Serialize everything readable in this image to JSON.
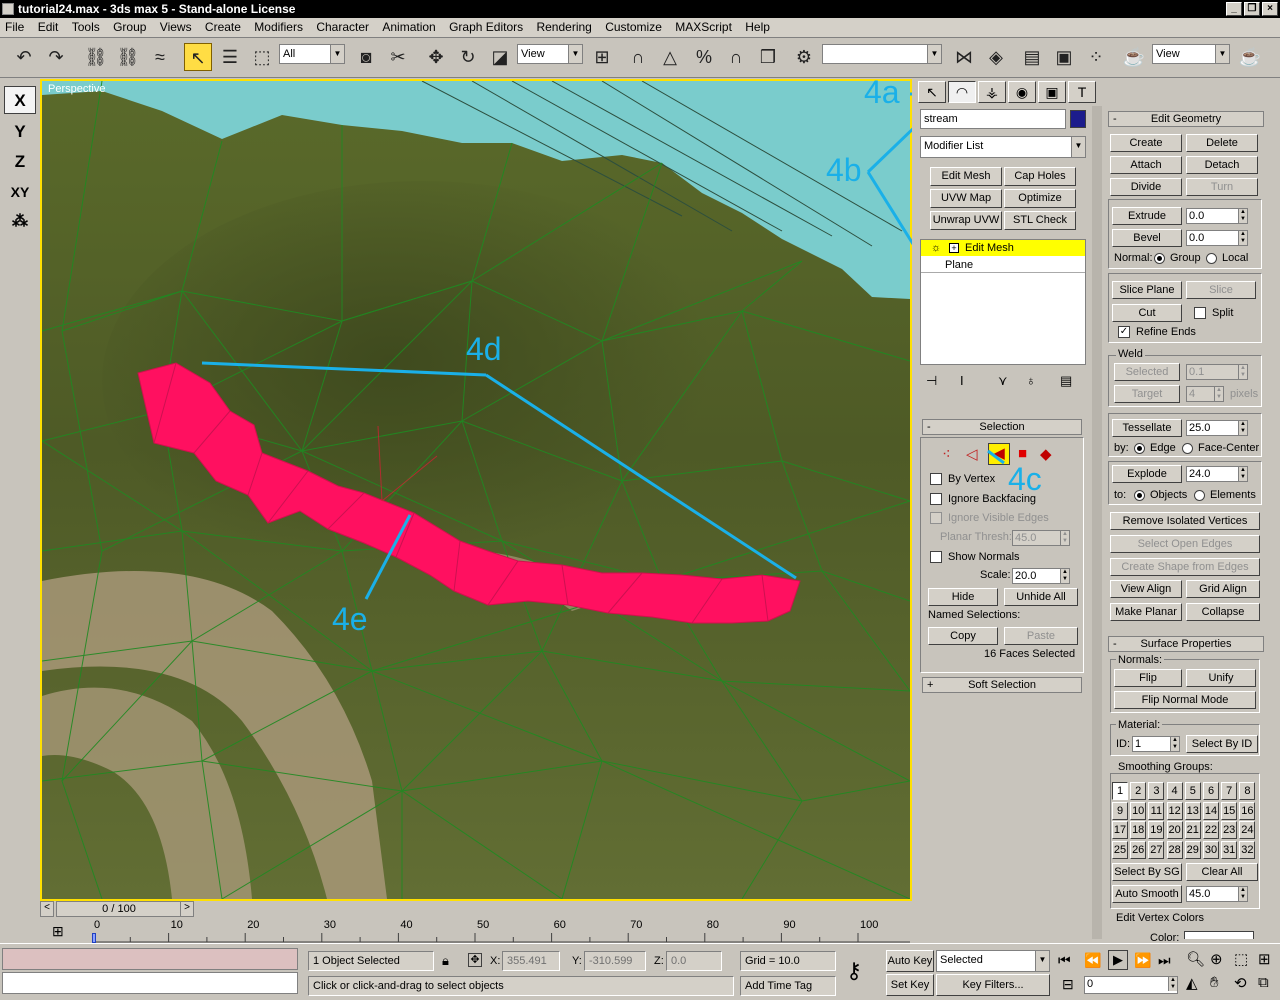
{
  "window": {
    "title": "tutorial24.max - 3ds max 5 - Stand-alone License"
  },
  "menu": [
    "File",
    "Edit",
    "Tools",
    "Group",
    "Views",
    "Create",
    "Modifiers",
    "Character",
    "Animation",
    "Graph Editors",
    "Rendering",
    "Customize",
    "MAXScript",
    "Help"
  ],
  "toolbar": {
    "selection_filter": "All",
    "ref_coord": "View",
    "named_sel": "",
    "render_view": "View"
  },
  "axes": [
    "X",
    "Y",
    "Z",
    "XY"
  ],
  "viewport": {
    "label": "Perspective"
  },
  "annotations": [
    "4a",
    "4b",
    "4c",
    "4d",
    "4e"
  ],
  "object": {
    "name": "stream",
    "color": "#1c1c8c"
  },
  "modifier_list": "Modifier List",
  "modifier_buttons": [
    "Edit Mesh",
    "Cap Holes",
    "UVW Map",
    "Optimize",
    "Unwrap UVW",
    "STL Check"
  ],
  "stack": {
    "active": "Edit Mesh",
    "base": "Plane"
  },
  "selection": {
    "title": "Selection",
    "by_vertex": "By Vertex",
    "ignore_backfacing": "Ignore Backfacing",
    "ignore_visible_edges": "Ignore Visible Edges",
    "planar_thresh_label": "Planar Thresh:",
    "planar_thresh": "45.0",
    "show_normals": "Show Normals",
    "scale_label": "Scale:",
    "scale": "20.0",
    "hide": "Hide",
    "unhide_all": "Unhide All",
    "named_selections": "Named Selections:",
    "copy": "Copy",
    "paste": "Paste",
    "status": "16 Faces Selected"
  },
  "soft_selection": "Soft Selection",
  "edit_geometry": {
    "title": "Edit Geometry",
    "create": "Create",
    "delete": "Delete",
    "attach": "Attach",
    "detach": "Detach",
    "divide": "Divide",
    "turn": "Turn",
    "extrude": "Extrude",
    "extrude_val": "0.0",
    "bevel": "Bevel",
    "bevel_val": "0.0",
    "normal_label": "Normal:",
    "group": "Group",
    "local": "Local",
    "slice_plane": "Slice Plane",
    "slice": "Slice",
    "cut": "Cut",
    "split": "Split",
    "refine_ends": "Refine Ends",
    "weld": "Weld",
    "selected": "Selected",
    "selected_val": "0.1",
    "target": "Target",
    "target_val": "4",
    "pixels": "pixels",
    "tessellate": "Tessellate",
    "tessellate_val": "25.0",
    "by_label": "by:",
    "edge": "Edge",
    "face_center": "Face-Center",
    "explode": "Explode",
    "explode_val": "24.0",
    "to_label": "to:",
    "objects": "Objects",
    "elements": "Elements",
    "remove_isolated": "Remove Isolated Vertices",
    "select_open_edges": "Select Open Edges",
    "create_shape": "Create Shape from Edges",
    "view_align": "View Align",
    "grid_align": "Grid Align",
    "make_planar": "Make Planar",
    "collapse": "Collapse"
  },
  "surface": {
    "title": "Surface Properties",
    "normals": "Normals:",
    "flip": "Flip",
    "unify": "Unify",
    "flip_normal_mode": "Flip Normal Mode",
    "material": "Material:",
    "id_label": "ID:",
    "id_val": "1",
    "select_by_id": "Select By ID",
    "smoothing_groups": "Smoothing Groups:",
    "sg": [
      "1",
      "2",
      "3",
      "4",
      "5",
      "6",
      "7",
      "8",
      "9",
      "10",
      "11",
      "12",
      "13",
      "14",
      "15",
      "16",
      "17",
      "18",
      "19",
      "20",
      "21",
      "22",
      "23",
      "24",
      "25",
      "26",
      "27",
      "28",
      "29",
      "30",
      "31",
      "32"
    ],
    "select_by_sg": "Select By SG",
    "clear_all": "Clear All",
    "auto_smooth": "Auto Smooth",
    "auto_smooth_val": "45.0",
    "edit_vertex_colors": "Edit Vertex Colors",
    "color": "Color:"
  },
  "timeline": {
    "frame": "0 / 100",
    "ticks": [
      "0",
      "10",
      "20",
      "30",
      "40",
      "50",
      "60",
      "70",
      "80",
      "90",
      "100"
    ]
  },
  "status": {
    "selected": "1 Object Selected",
    "x_label": "X:",
    "x": "355.491",
    "y_label": "Y:",
    "y": "-310.599",
    "z_label": "Z:",
    "z": "0.0",
    "grid": "Grid = 10.0",
    "prompt": "Click or click-and-drag to select objects",
    "add_time_tag": "Add Time Tag",
    "auto_key": "Auto Key",
    "set_key": "Set Key",
    "key_mode": "Selected",
    "key_filters": "Key Filters...",
    "current_frame": "0"
  }
}
